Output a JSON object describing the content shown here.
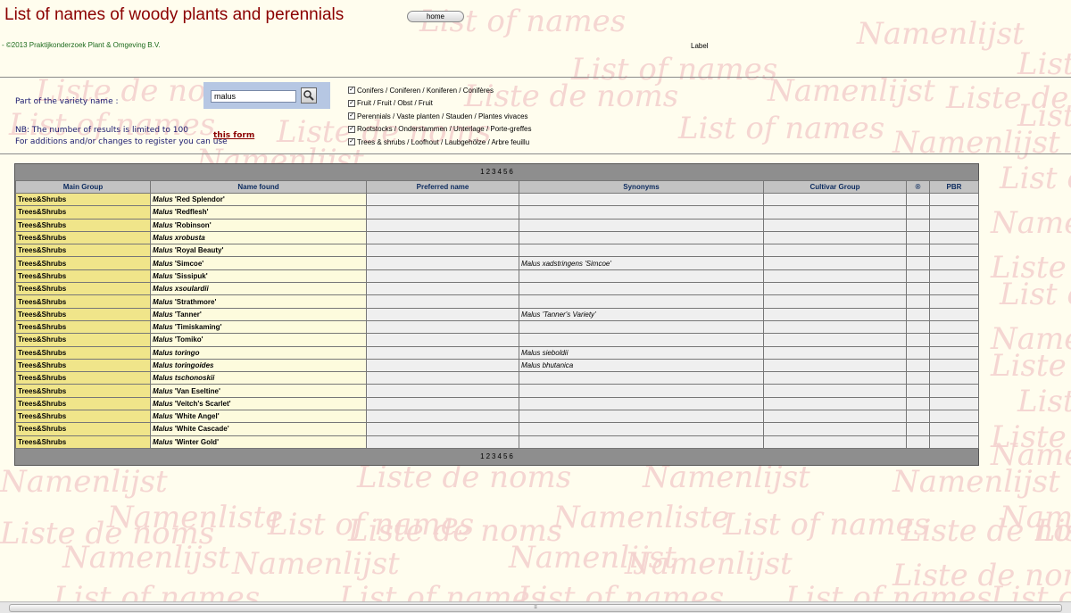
{
  "page": {
    "title": "List of names of woody plants and perennials",
    "home_label": "home",
    "copyright": "- ©2013 Praktijkonderzoek Plant & Omgeving B.V.",
    "label": "Label"
  },
  "form": {
    "variety_label": "Part of the variety name :",
    "search_value": "malus",
    "nb_line1": "NB: The number of results is limited to 100",
    "nb_line2": "For additions and/or changes to register you can use",
    "this_form": "this form",
    "checkboxes": [
      {
        "label": "Conifers / Coniferen / Koniferen / Conifères",
        "checked": true
      },
      {
        "label": "Fruit / Fruit / Obst / Fruit",
        "checked": true
      },
      {
        "label": "Perennials / Vaste planten / Stauden / Plantes vivaces",
        "checked": true
      },
      {
        "label": "Rootstocks / Onderstammen / Unterlage / Porte-greffes",
        "checked": true
      },
      {
        "label": "Trees & shrubs / Loofhout / Laubgehölze / Arbre feuillu",
        "checked": true
      }
    ]
  },
  "results": {
    "pages": [
      "1",
      "2",
      "3",
      "4",
      "5",
      "6"
    ],
    "columns": [
      "Main Group",
      "Name found",
      "Preferred name",
      "Synonyms",
      "Cultivar Group",
      "®",
      "PBR"
    ],
    "rows": [
      {
        "group": "Trees&Shrubs",
        "genus": "Malus",
        "name": "'Red Splendor'",
        "syn": ""
      },
      {
        "group": "Trees&Shrubs",
        "genus": "Malus",
        "name": "'Redflesh'",
        "syn": ""
      },
      {
        "group": "Trees&Shrubs",
        "genus": "Malus",
        "name": "'Robinson'",
        "syn": ""
      },
      {
        "group": "Trees&Shrubs",
        "genus": "Malus",
        "name": "xrobusta",
        "syn": ""
      },
      {
        "group": "Trees&Shrubs",
        "genus": "Malus",
        "name": "'Royal Beauty'",
        "syn": ""
      },
      {
        "group": "Trees&Shrubs",
        "genus": "Malus",
        "name": "'Simcoe'",
        "syn": "Malus xadstringens 'Simcoe'"
      },
      {
        "group": "Trees&Shrubs",
        "genus": "Malus",
        "name": "'Sissipuk'",
        "syn": ""
      },
      {
        "group": "Trees&Shrubs",
        "genus": "Malus",
        "name": "xsoulardii",
        "syn": ""
      },
      {
        "group": "Trees&Shrubs",
        "genus": "Malus",
        "name": "'Strathmore'",
        "syn": ""
      },
      {
        "group": "Trees&Shrubs",
        "genus": "Malus",
        "name": "'Tanner'",
        "syn": "Malus 'Tanner's Variety'"
      },
      {
        "group": "Trees&Shrubs",
        "genus": "Malus",
        "name": "'Timiskaming'",
        "syn": ""
      },
      {
        "group": "Trees&Shrubs",
        "genus": "Malus",
        "name": "'Tomiko'",
        "syn": ""
      },
      {
        "group": "Trees&Shrubs",
        "genus": "Malus",
        "name": "toringo",
        "syn": "Malus sieboldii"
      },
      {
        "group": "Trees&Shrubs",
        "genus": "Malus",
        "name": "toringoides",
        "syn": "Malus bhutanica"
      },
      {
        "group": "Trees&Shrubs",
        "genus": "Malus",
        "name": "tschonoskii",
        "syn": ""
      },
      {
        "group": "Trees&Shrubs",
        "genus": "Malus",
        "name": "'Van Eseltine'",
        "syn": ""
      },
      {
        "group": "Trees&Shrubs",
        "genus": "Malus",
        "name": "'Veitch's Scarlet'",
        "syn": ""
      },
      {
        "group": "Trees&Shrubs",
        "genus": "Malus",
        "name": "'White Angel'",
        "syn": ""
      },
      {
        "group": "Trees&Shrubs",
        "genus": "Malus",
        "name": "'White Cascade'",
        "syn": ""
      },
      {
        "group": "Trees&Shrubs",
        "genus": "Malus",
        "name": "'Winter Gold'",
        "syn": ""
      }
    ]
  },
  "watermark": {
    "phrases": [
      "List of names",
      "Liste de noms",
      "Namenlijst",
      "Namenliste"
    ]
  },
  "scrollbar": {
    "thumb_glyph": "≡"
  },
  "colors": {
    "title": "#8b0000",
    "copyright": "#1d6b1d",
    "group_cell": "#f0e58a",
    "name_cell": "#fdfbdd",
    "header": "#c3c3c3",
    "pager": "#8e8e8e"
  }
}
